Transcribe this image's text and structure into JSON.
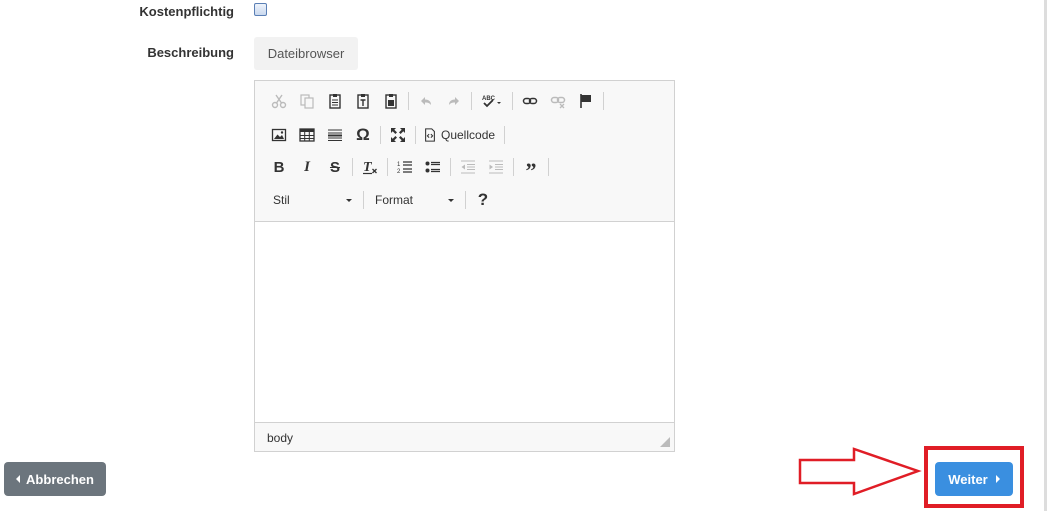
{
  "form": {
    "kostenpflichtig_label": "Kostenpflichtig",
    "kostenpflichtig_checked": false,
    "beschreibung_label": "Beschreibung",
    "dateibrowser_button": "Dateibrowser"
  },
  "editor": {
    "toolbar": {
      "row1": [
        "cut-icon",
        "copy-icon",
        "paste-icon",
        "paste-text-icon",
        "paste-word-icon",
        "undo-icon",
        "redo-icon",
        "spellcheck-icon",
        "link-icon",
        "unlink-icon",
        "anchor-icon"
      ],
      "row2": [
        "image-icon",
        "table-icon",
        "horizontal-rule-icon",
        "special-char-icon",
        "maximize-icon",
        "source-icon"
      ],
      "source_label": "Quellcode",
      "row3": [
        "bold-icon",
        "italic-icon",
        "strike-icon",
        "remove-format-icon",
        "numbered-list-icon",
        "bulleted-list-icon",
        "outdent-icon",
        "indent-icon",
        "blockquote-icon"
      ],
      "style_combo": "Stil",
      "format_combo": "Format",
      "help_label": "?"
    },
    "content": "",
    "status_path": "body"
  },
  "actions": {
    "abbrechen_label": "Abbrechen",
    "weiter_label": "Weiter"
  },
  "colors": {
    "primary": "#3a8fe0",
    "secondary": "#6c757d",
    "highlight": "#e01d26"
  }
}
